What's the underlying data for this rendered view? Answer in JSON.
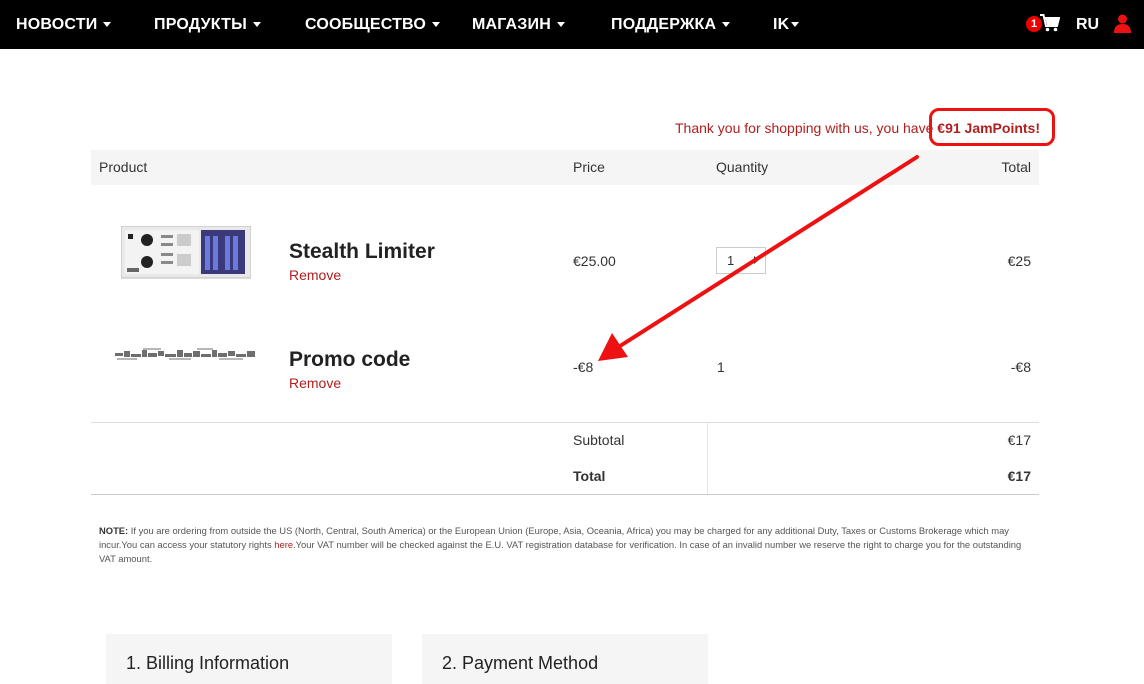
{
  "nav": {
    "items": [
      {
        "label": "НОВОСТИ"
      },
      {
        "label": "ПРОДУКТЫ"
      },
      {
        "label": "СООБЩЕСТВО"
      },
      {
        "label": "МАГАЗИН"
      },
      {
        "label": "ПОДДЕРЖКА"
      },
      {
        "label": "IK"
      }
    ],
    "cart_count": "1",
    "lang": "RU",
    "icons": {
      "cart": "cart-icon",
      "user": "user-icon"
    }
  },
  "thanks": {
    "prefix": "Thank you for shopping with us, you have ",
    "points": "€91 JamPoints!"
  },
  "table": {
    "headers": {
      "product": "Product",
      "price": "Price",
      "quantity": "Quantity",
      "total": "Total"
    },
    "rows": [
      {
        "name": "Stealth Limiter",
        "remove": "Remove",
        "price": "€25.00",
        "quantity": "1",
        "total": "€25"
      },
      {
        "name": "Promo code",
        "remove": "Remove",
        "price": "-€8",
        "quantity": "1",
        "total": "-€8"
      }
    ],
    "subtotal_label": "Subtotal",
    "subtotal_value": "€17",
    "total_label": "Total",
    "total_value": "€17"
  },
  "note": {
    "label": "NOTE:",
    "text1": " If you are ordering from outside the US (North, Central, South America) or the European Union (Europe, Asia, Oceania, Africa) you may be charged for any additional Duty, Taxes or Customs Brokerage which may incur.You can access your statutory rights ",
    "link": "here",
    "text2": ".Your VAT number will be checked against the E.U. VAT registration database for verification. In case of an invalid number we reserve the right to charge you for the outstanding VAT amount."
  },
  "steps": [
    {
      "label": "1. Billing Information"
    },
    {
      "label": "2. Payment Method"
    }
  ],
  "colors": {
    "accent": "#b01e1e",
    "annotation": "#ee1111",
    "nav_bg": "#000000"
  }
}
